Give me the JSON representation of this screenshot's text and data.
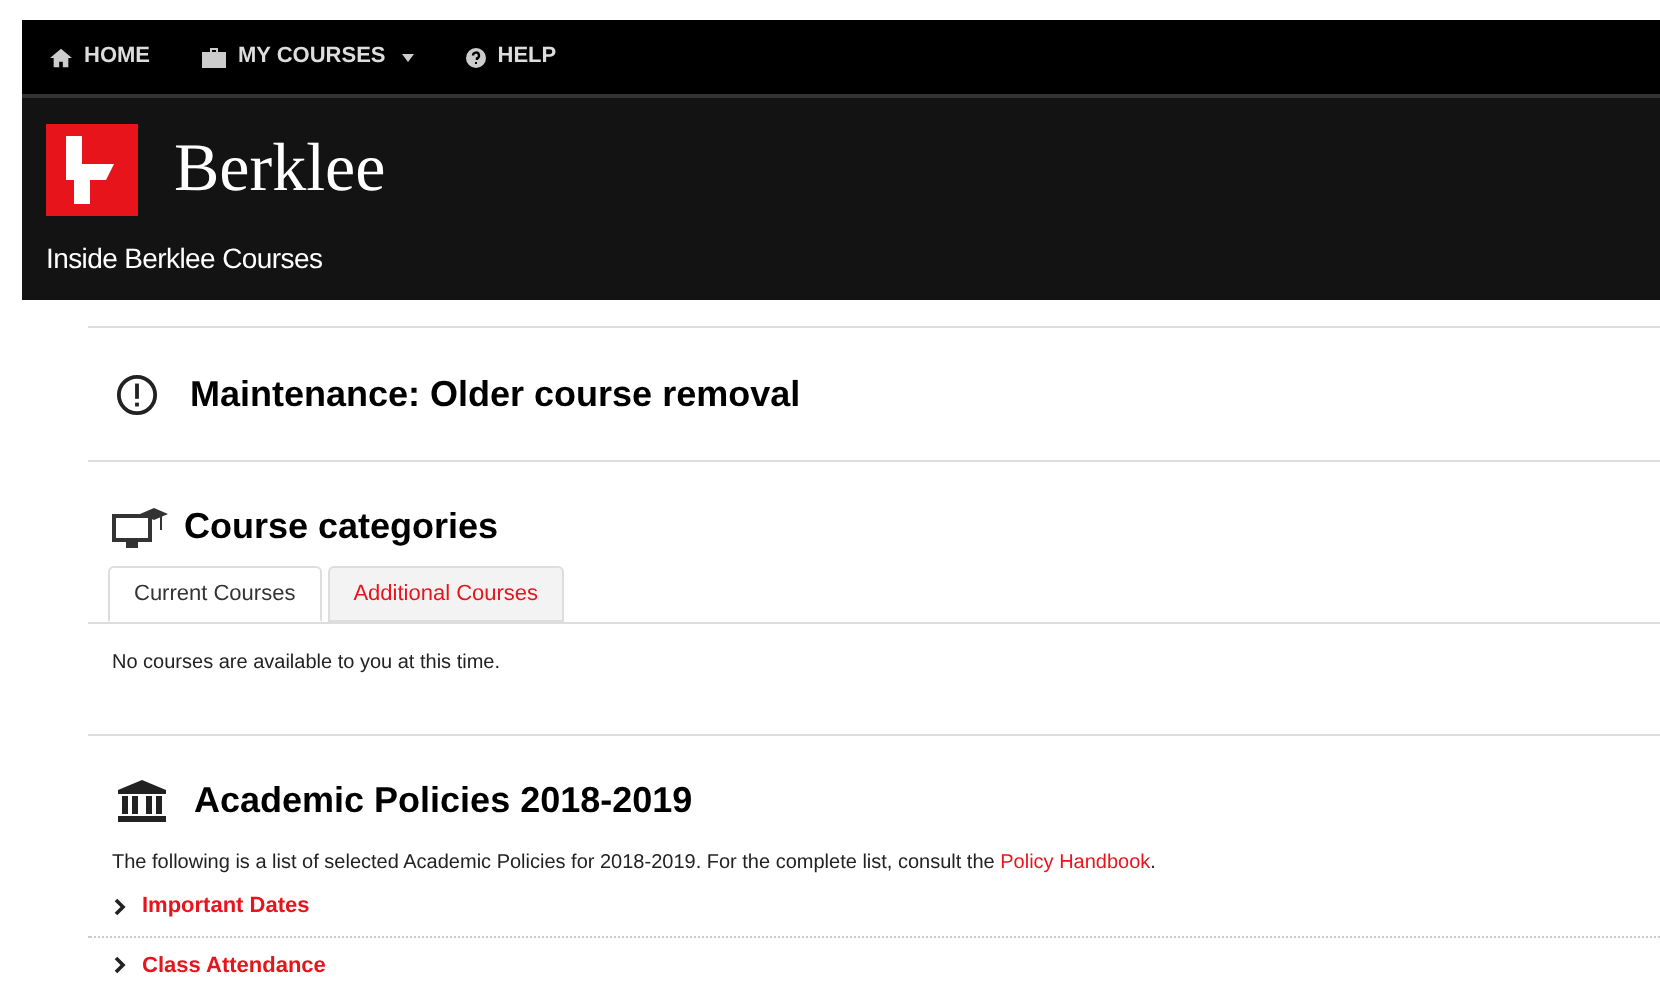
{
  "nav": [
    {
      "kind": "home",
      "label": "HOME",
      "dropdown": false
    },
    {
      "kind": "courses",
      "label": "MY COURSES",
      "dropdown": true
    },
    {
      "kind": "help",
      "label": "HELP",
      "dropdown": false
    }
  ],
  "header": {
    "brand": "Berklee",
    "subtitle": "Inside Berklee Courses"
  },
  "maintenance": {
    "title": "Maintenance: Older course removal"
  },
  "categories": {
    "title": "Course categories",
    "tabs": [
      {
        "label": "Current Courses",
        "selected": true
      },
      {
        "label": "Additional Courses",
        "selected": false
      }
    ],
    "message": "No courses are available to you at this time."
  },
  "policies": {
    "title": "Academic Policies 2018-2019",
    "intro": "The following is a list of selected Academic Policies for 2018-2019. For the complete list, consult the ",
    "link": "Policy Handbook",
    "intro_end": ".",
    "items": [
      {
        "label": "Important Dates",
        "expanded": false
      },
      {
        "label": "Class Attendance",
        "expanded": false
      }
    ]
  }
}
